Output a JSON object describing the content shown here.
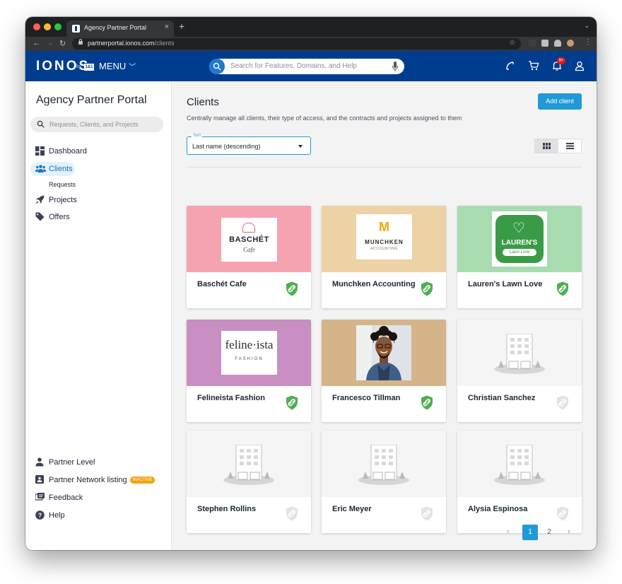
{
  "browser": {
    "tab_title": "Agency Partner Portal",
    "new_tab": "+",
    "url_host": "partnerportal.ionos.com",
    "url_path": "/clients"
  },
  "header": {
    "logo": "IONOS",
    "logo_by": "by",
    "logo_1and1": "1&1",
    "menu_label": "MENU",
    "search_placeholder": "Search for Features, Domains, and Help",
    "notification_count": "9+"
  },
  "sidebar": {
    "title": "Agency Partner Portal",
    "search_placeholder": "Requests, Clients, and Projects",
    "items": [
      {
        "label": "Dashboard"
      },
      {
        "label": "Clients"
      },
      {
        "label": "Projects"
      },
      {
        "label": "Offers"
      }
    ],
    "sub_item": "Requests",
    "bottom_items": [
      {
        "label": "Partner Level"
      },
      {
        "label": "Partner Network listing",
        "badge": "INACTIVE"
      },
      {
        "label": "Feedback"
      },
      {
        "label": "Help"
      }
    ]
  },
  "main": {
    "title": "Clients",
    "subtitle": "Centrally manage all clients, their type of access, and the contracts and projects assigned to them",
    "add_button": "Add client",
    "sort_label": "Sort",
    "sort_value": "Last name (descending)",
    "clients": [
      {
        "name": "Baschét Cafe",
        "logo": "baschet",
        "linked": true,
        "bg": "#f5a3b1",
        "logo_text": "BASCHÉT",
        "logo_sub": "Cafe"
      },
      {
        "name": "Munchken Accounting",
        "logo": "munchken",
        "linked": true,
        "bg": "#ecd2a4",
        "logo_text": "MUNCHKEN",
        "logo_sub": "ACCOUNTING",
        "logo_mark": "M"
      },
      {
        "name": "Lauren's Lawn Love",
        "logo": "lauren",
        "linked": true,
        "bg": "#a8dcb0",
        "logo_text": "LAUREN'S",
        "logo_sub": "Lawn Love"
      },
      {
        "name": "Felineista Fashion",
        "logo": "feline",
        "linked": true,
        "bg": "#c98fc2",
        "logo_text": "feline·ista",
        "logo_sub": "FASHION"
      },
      {
        "name": "Francesco Tillman",
        "logo": "photo",
        "linked": true,
        "bg": "#d6b48a"
      },
      {
        "name": "Christian Sanchez",
        "logo": "placeholder",
        "linked": false,
        "bg": "#f5f5f5"
      },
      {
        "name": "Stephen Rollins",
        "logo": "placeholder",
        "linked": false,
        "bg": "#f5f5f5"
      },
      {
        "name": "Eric Meyer",
        "logo": "placeholder",
        "linked": false,
        "bg": "#f5f5f5"
      },
      {
        "name": "Alysia Espinosa",
        "logo": "placeholder",
        "linked": false,
        "bg": "#f5f5f5"
      }
    ],
    "pagination": {
      "prev": "‹",
      "pages": [
        "1",
        "2"
      ],
      "current": "1",
      "next": "›"
    }
  },
  "colors": {
    "brand": "#003d8f",
    "accent": "#1f9ad6",
    "linked_shield": "#4caf50",
    "unlinked_shield": "#e3e3e3",
    "badge_inactive": "#f2a20b"
  }
}
